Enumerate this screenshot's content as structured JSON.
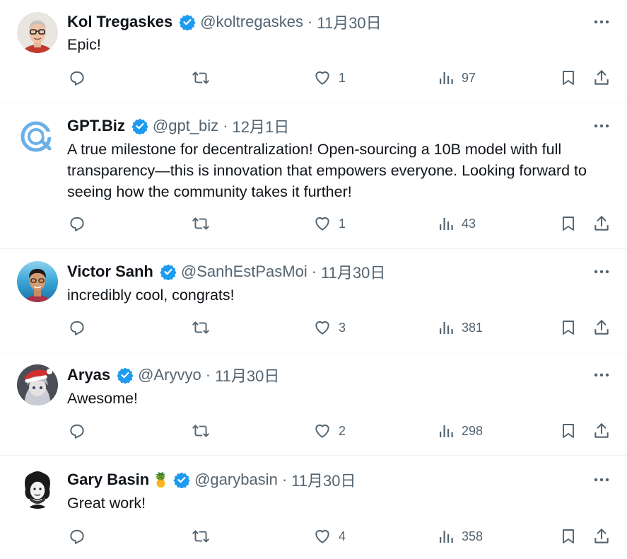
{
  "tweets": [
    {
      "name": "Kol Tregaskes",
      "emoji": "",
      "handle": "@koltregaskes",
      "separator": "·",
      "date": "11月30日",
      "text": "Epic!",
      "likes": "1",
      "views": "97",
      "avatar": "person-glasses"
    },
    {
      "name": "GPT.Biz",
      "emoji": "",
      "handle": "@gpt_biz",
      "separator": "·",
      "date": "12月1日",
      "text": "A true milestone for decentralization! Open-sourcing a 10B model with full transparency—this is innovation that empowers everyone. Looking forward to seeing how the community takes it further!",
      "likes": "1",
      "views": "43",
      "avatar": "gpt-biz-logo"
    },
    {
      "name": "Victor Sanh",
      "emoji": "",
      "handle": "@SanhEstPasMoi",
      "separator": "·",
      "date": "11月30日",
      "text": "incredibly cool, congrats!",
      "likes": "3",
      "views": "381",
      "avatar": "person-sea"
    },
    {
      "name": "Aryas",
      "emoji": "",
      "handle": "@Aryvyo",
      "separator": "·",
      "date": "11月30日",
      "text": "Awesome!",
      "likes": "2",
      "views": "298",
      "avatar": "anime-santa"
    },
    {
      "name": "Gary Basin",
      "emoji": "🍍",
      "handle": "@garybasin",
      "separator": "·",
      "date": "11月30日",
      "text": "Great work!",
      "likes": "4",
      "views": "358",
      "avatar": "cartoon-curly"
    }
  ],
  "colors": {
    "verified": "#1d9bf0",
    "muted": "#536471",
    "text": "#0f1419",
    "divider": "#eff3f4"
  }
}
